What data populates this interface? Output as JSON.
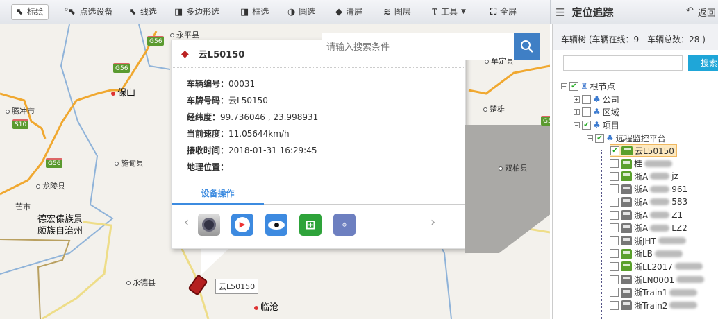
{
  "toolbar": {
    "items": [
      {
        "label": "标绘",
        "icon": "cursor-pin-icon"
      },
      {
        "label": "点选设备",
        "icon": "point-select-icon"
      },
      {
        "label": "线选",
        "icon": "line-select-icon"
      },
      {
        "label": "多边形选",
        "icon": "polygon-select-icon"
      },
      {
        "label": "框选",
        "icon": "box-select-icon"
      },
      {
        "label": "圆选",
        "icon": "circle-select-icon"
      },
      {
        "label": "清屏",
        "icon": "eraser-icon"
      },
      {
        "label": "图层",
        "icon": "layers-icon"
      },
      {
        "label": "工具",
        "icon": "wrench-icon"
      },
      {
        "label": "全屏",
        "icon": "fullscreen-icon"
      }
    ],
    "panel_title": "定位追踪",
    "back_label": "返回"
  },
  "map": {
    "search_placeholder": "请输入搜索条件",
    "cities": [
      "永平县",
      "保山",
      "腾冲市",
      "施甸县",
      "龙陵县",
      "芒市",
      "德宏傣族景",
      "颇族自治州",
      "永德县",
      "临沧",
      "楚雄",
      "双柏县",
      "牟定县"
    ],
    "shields": [
      "G56",
      "G56",
      "G56",
      "S10",
      "G5"
    ],
    "marker_label": "云L50150"
  },
  "popup": {
    "title": "云L50150",
    "fields": [
      {
        "label": "车辆编号：",
        "value": "00031"
      },
      {
        "label": "车牌号码：",
        "value": "云L50150"
      },
      {
        "label": "经纬度：",
        "value": "99.736046 , 23.998931"
      },
      {
        "label": "当前速度：",
        "value": "11.05644km/h"
      },
      {
        "label": "接收时间：",
        "value": "2018-01-31 16:29:45"
      },
      {
        "label": "地理位置：",
        "value": ""
      }
    ],
    "tab": "设备操作",
    "actions": [
      "camera-icon",
      "video-playback-icon",
      "monitor-eye-icon",
      "add-record-icon",
      "track-route-icon"
    ]
  },
  "panel": {
    "header": "车辆树 (车辆在线：9　车辆总数：28 )",
    "search_button": "搜索",
    "tree": {
      "root": "根节点",
      "groups": [
        "公司",
        "区域",
        "项目"
      ],
      "platform": "远程监控平台",
      "vehicles": [
        {
          "name": "云L50150",
          "online": true,
          "checked": true
        },
        {
          "name": "桂",
          "online": true,
          "checked": false
        },
        {
          "name": "浙A",
          "suffix": "jz",
          "online": true,
          "checked": false
        },
        {
          "name": "浙A",
          "suffix": "961",
          "online": false,
          "checked": false
        },
        {
          "name": "浙A",
          "suffix": "583",
          "online": false,
          "checked": false
        },
        {
          "name": "浙A",
          "suffix": "Z1",
          "online": false,
          "checked": false
        },
        {
          "name": "浙A",
          "suffix": "LZ2",
          "online": false,
          "checked": false
        },
        {
          "name": "浙JHT",
          "suffix": "",
          "online": false,
          "checked": false
        },
        {
          "name": "浙LB",
          "suffix": "",
          "online": true,
          "checked": false
        },
        {
          "name": "浙LL2017",
          "suffix": "",
          "online": true,
          "checked": false
        },
        {
          "name": "浙LN0001",
          "suffix": "",
          "online": false,
          "checked": false
        },
        {
          "name": "浙Train1",
          "suffix": "",
          "online": false,
          "checked": false
        },
        {
          "name": "浙Train2",
          "suffix": "",
          "online": false,
          "checked": false
        }
      ]
    }
  },
  "colors": {
    "accent": "#3c8be0",
    "search_btn": "#3f7fc5",
    "online": "#5aa02c",
    "offline": "#777777",
    "tree_search": "#1fa6d8"
  }
}
